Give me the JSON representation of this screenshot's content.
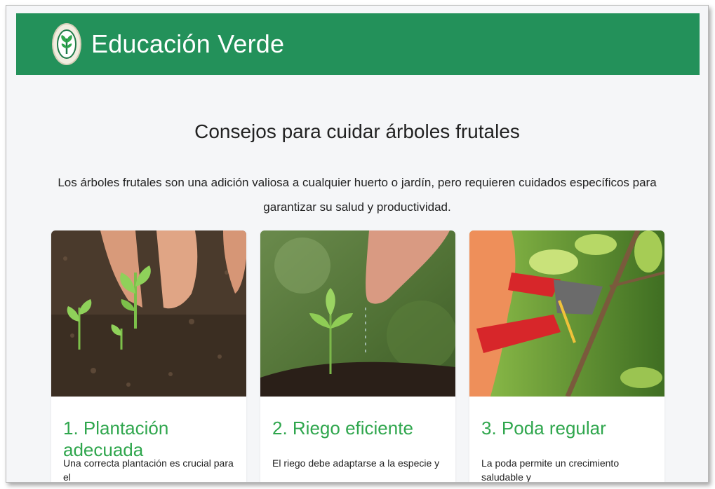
{
  "header": {
    "brand": "Educación Verde",
    "logo_icon": "sprout-logo-icon",
    "background_color": "#23915a"
  },
  "main": {
    "title": "Consejos para cuidar árboles frutales",
    "intro": "Los árboles frutales son una adición valiosa a cualquier huerto o jardín, pero requieren cuidados específicos para garantizar su salud y productividad.",
    "cards": [
      {
        "title": "1. Plantación adecuada",
        "text": "Una correcta plantación es crucial para el",
        "image": "planting-seedlings-image"
      },
      {
        "title": "2. Riego eficiente",
        "text": "El riego debe adaptarse a la especie y",
        "image": "watering-sprout-image"
      },
      {
        "title": "3. Poda regular",
        "text": "La poda permite un crecimiento saludable y",
        "image": "pruning-shears-image"
      }
    ],
    "accent_color": "#2fa64d"
  }
}
